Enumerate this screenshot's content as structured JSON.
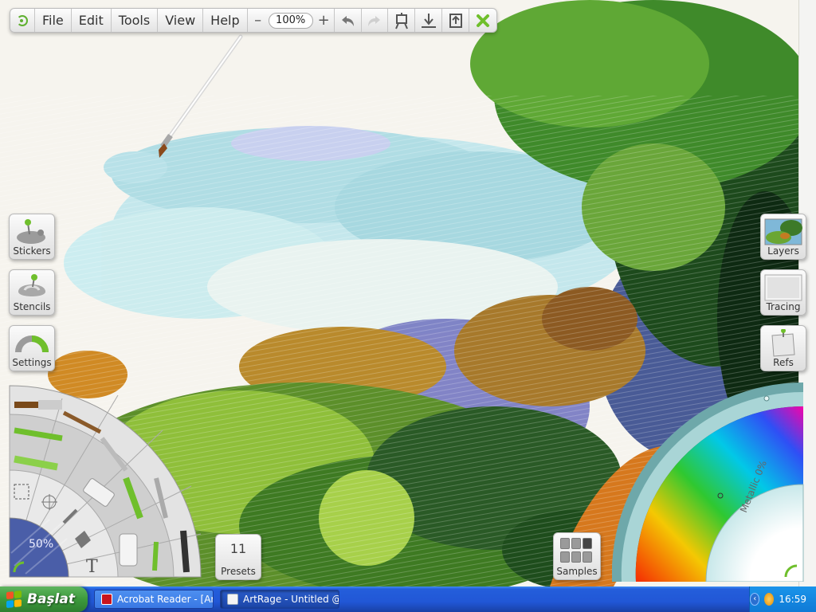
{
  "menubar": {
    "menus": [
      "File",
      "Edit",
      "Tools",
      "View",
      "Help"
    ],
    "zoom_minus": "–",
    "zoom_value": "100%",
    "zoom_plus": "+",
    "icons": [
      "undo-icon",
      "redo-icon",
      "easel-icon",
      "import-icon",
      "export-icon",
      "close-icon"
    ]
  },
  "left_pods": {
    "stickers": "Stickers",
    "stencils": "Stencils",
    "settings": "Settings"
  },
  "right_pods": {
    "layers": "Layers",
    "tracing": "Tracing",
    "refs": "Refs"
  },
  "toolwheel": {
    "opacity": "50%",
    "tools": [
      "oil-brush",
      "watercolor",
      "pencil",
      "chalk",
      "crayon",
      "palette-knife",
      "paint-tube",
      "marker",
      "airbrush",
      "pen",
      "paint-roller",
      "ink-pen",
      "selection",
      "transform",
      "eyedropper",
      "fill",
      "text"
    ]
  },
  "presets": {
    "count": "11",
    "label": "Presets"
  },
  "samples": {
    "label": "Samples"
  },
  "colorpicker": {
    "metallic": "Metallic 0%"
  },
  "taskbar": {
    "start": "Başlat",
    "tasks": [
      {
        "label": "Acrobat Reader - [Ar..."
      },
      {
        "label": "ArtRage - Untitled @"
      }
    ],
    "clock": "16:59",
    "tray_expand": "‹"
  },
  "colors": {
    "accent_green": "#5fb030",
    "taskbar_blue": "#245edb",
    "start_green": "#3c9a3c"
  }
}
